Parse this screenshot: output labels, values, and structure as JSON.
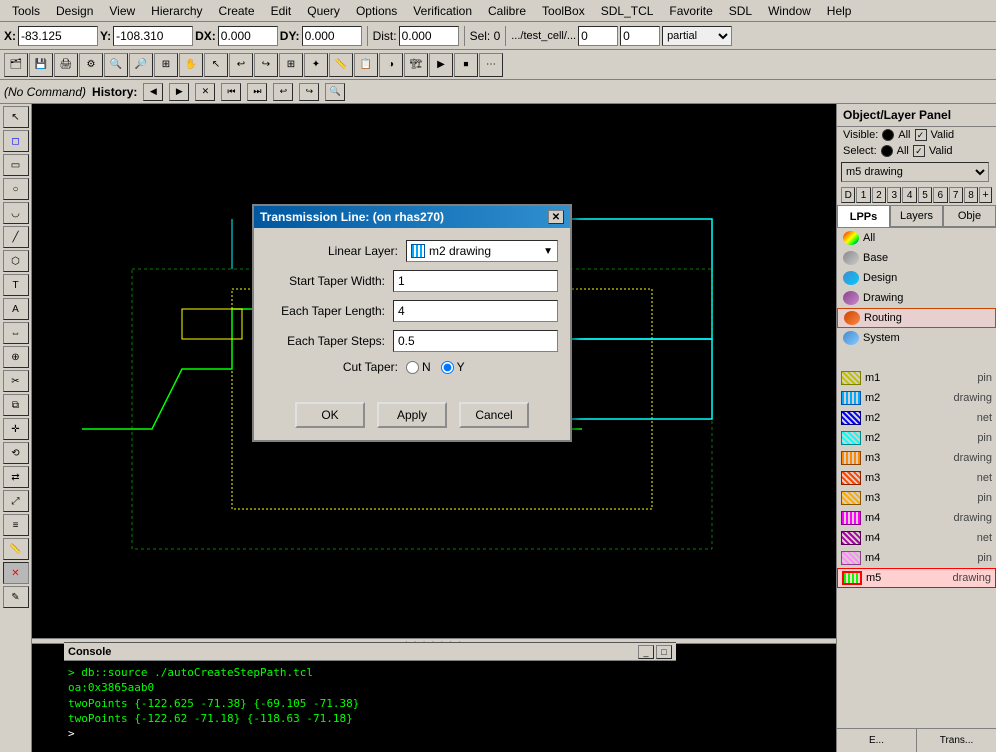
{
  "menubar": {
    "items": [
      "Tools",
      "Design",
      "View",
      "Hierarchy",
      "Create",
      "Edit",
      "Query",
      "Options",
      "Verification",
      "Calibre",
      "ToolBox",
      "SDL_TCL",
      "Favorite",
      "SDL",
      "Window",
      "Help"
    ]
  },
  "toolbar": {
    "x_label": "X:",
    "x_value": "-83.125",
    "y_label": "Y:",
    "y_value": "-108.310",
    "dx_label": "DX:",
    "dx_value": "0.000",
    "dy_label": "DY:",
    "dy_value": "0.000",
    "dist_label": "Dist:",
    "dist_value": "0.000",
    "sel_label": "Sel: 0",
    "partial_value": "partial",
    "path_display": ".../test_cell/..."
  },
  "cmd_bar": {
    "command_label": "(No Command)",
    "history_label": "History:"
  },
  "dialog": {
    "title": "Transmission Line: (on rhas270)",
    "linear_layer_label": "Linear Layer:",
    "linear_layer_value": "m2 drawing",
    "start_taper_width_label": "Start Taper Width:",
    "start_taper_width_value": "1",
    "each_taper_length_label": "Each Taper Length:",
    "each_taper_length_value": "4",
    "each_taper_steps_label": "Each Taper Steps:",
    "each_taper_steps_value": "0.5",
    "cut_taper_label": "Cut Taper:",
    "radio_n_label": "N",
    "radio_y_label": "Y",
    "ok_label": "OK",
    "apply_label": "Apply",
    "cancel_label": "Cancel"
  },
  "right_panel": {
    "title": "Object/Layer Panel",
    "visible_label": "Visible:",
    "visible_all_label": "All",
    "visible_valid_label": "Valid",
    "select_label": "Select:",
    "select_all_label": "All",
    "select_valid_label": "Valid",
    "layer_dropdown": "m5 drawing",
    "layer_nums": [
      "D",
      "1",
      "2",
      "3",
      "4",
      "5",
      "6",
      "7",
      "8"
    ],
    "tabs": [
      "LPPs",
      "Layers",
      "Obje"
    ],
    "categories": [
      {
        "name": "All",
        "dot_color": "#333"
      },
      {
        "name": "Base",
        "dot_color": "#888"
      },
      {
        "name": "Design",
        "dot_color": "#4488cc"
      },
      {
        "name": "Drawing",
        "dot_color": "#884488"
      },
      {
        "name": "Routing",
        "dot_color": "#cc4400"
      },
      {
        "name": "System",
        "dot_color": "#4488cc"
      }
    ],
    "layers": [
      {
        "name": "m1",
        "type": "pin",
        "swatch_class": "swatch-m1-pin"
      },
      {
        "name": "m2",
        "type": "drawing",
        "swatch_class": "swatch-m2-drawing"
      },
      {
        "name": "m2",
        "type": "net",
        "swatch_class": "swatch-m2-net"
      },
      {
        "name": "m2",
        "type": "pin",
        "swatch_class": "swatch-m2-pin"
      },
      {
        "name": "m3",
        "type": "drawing",
        "swatch_class": "swatch-m3-drawing"
      },
      {
        "name": "m3",
        "type": "net",
        "swatch_class": "swatch-m3-net"
      },
      {
        "name": "m3",
        "type": "pin",
        "swatch_class": "swatch-m3-pin"
      },
      {
        "name": "m4",
        "type": "drawing",
        "swatch_class": "swatch-m4-drawing"
      },
      {
        "name": "m4",
        "type": "net",
        "swatch_class": "swatch-m4-net"
      },
      {
        "name": "m4",
        "type": "pin",
        "swatch_class": "swatch-m4-pin"
      },
      {
        "name": "m5",
        "type": "drawing",
        "swatch_class": "swatch-m5-drawing",
        "selected": true
      }
    ],
    "bottom_tabs": [
      "E...",
      "Trans..."
    ]
  },
  "console": {
    "title": "Console",
    "lines": [
      "> db::source ./autoCreateStepPath.tcl",
      "oa:0x3865aab0",
      "twoPoints {-122.625 -71.38} {-69.105 -71.38}",
      "twoPoints {-122.62 -71.18} {-118.63 -71.18}"
    ],
    "prompt": ">"
  },
  "left_tools": {
    "icons": [
      "↖",
      "✏",
      "⬚",
      "⟰",
      "⤢",
      "↔",
      "◻",
      "⬜",
      "⟲",
      "⟳",
      "◈",
      "▣",
      "⊞",
      "⊠",
      "✂",
      "⊕",
      "⊗",
      "✦",
      "◐",
      "⚙",
      "✕",
      "✎"
    ]
  }
}
